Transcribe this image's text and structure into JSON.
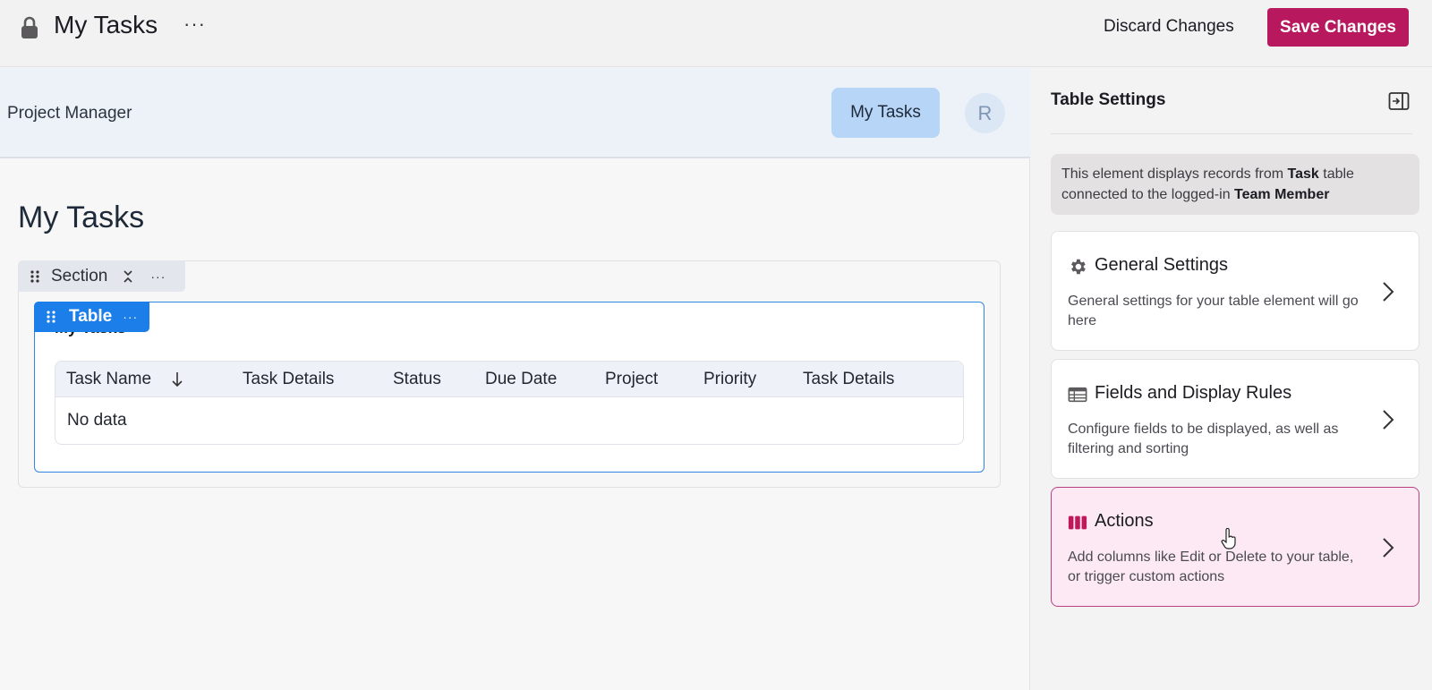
{
  "topbar": {
    "lock_icon": "lock-icon",
    "title": "My Tasks",
    "more_label": "···",
    "discard_label": "Discard Changes",
    "save_label": "Save Changes",
    "save_color": "#b8195e"
  },
  "app_header": {
    "app_name": "Project Manager",
    "nav_active_label": "My Tasks",
    "avatar_initial": "R"
  },
  "canvas": {
    "page_title": "My Tasks",
    "section": {
      "label": "Section",
      "more_label": "···"
    },
    "table_element": {
      "label": "Table",
      "more_label": "···",
      "heading": "My Tasks",
      "columns": [
        "Task Name",
        "Task Details",
        "Status",
        "Due Date",
        "Project",
        "Priority",
        "Task Details"
      ],
      "empty_text": "No data",
      "accent": "#1c7ee8"
    }
  },
  "panel": {
    "title": "Table Settings",
    "info": {
      "part1": "This element displays records from ",
      "bold1": "Task",
      "part2": " table connected to the logged-in ",
      "bold2": "Team Member"
    },
    "cards": [
      {
        "icon": "gear-icon",
        "title": "General Settings",
        "description": "General settings for your table element will go here"
      },
      {
        "icon": "table-icon",
        "title": "Fields and Display Rules",
        "description": "Configure fields to be displayed, as well as filtering and sorting"
      },
      {
        "icon": "columns-icon",
        "title": "Actions",
        "description": "Add columns like Edit or Delete to your table, or trigger custom actions"
      }
    ]
  }
}
